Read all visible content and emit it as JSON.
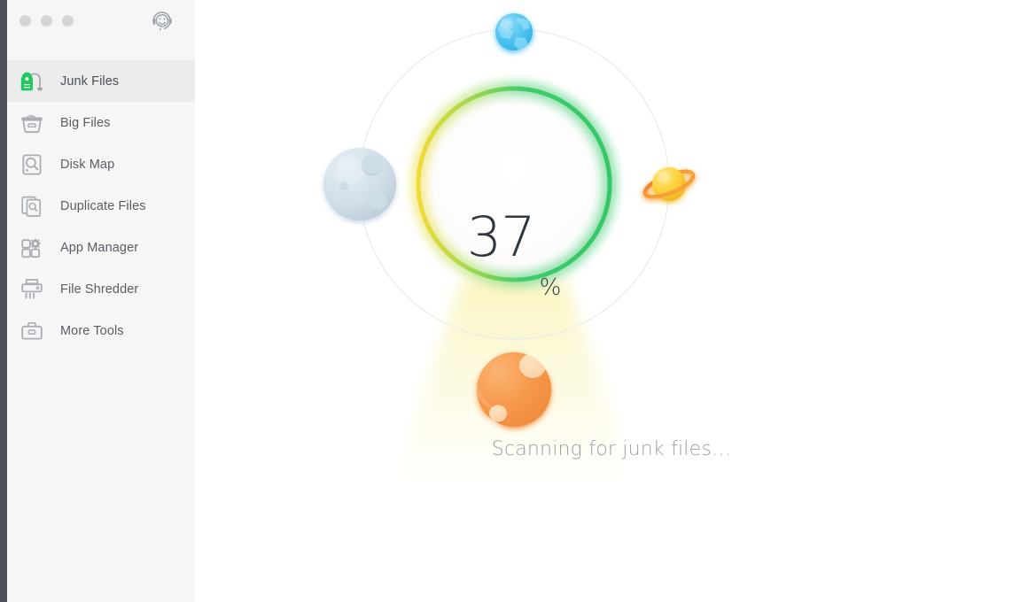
{
  "window": {
    "traffic_lights": [
      "close",
      "minimize",
      "zoom"
    ],
    "support_icon": "support-smiley-icon"
  },
  "sidebar": {
    "items": [
      {
        "label": "Junk Files",
        "icon": "vacuum-cleaner-icon",
        "active": true
      },
      {
        "label": "Big Files",
        "icon": "basket-icon",
        "active": false
      },
      {
        "label": "Disk Map",
        "icon": "disk-magnifier-icon",
        "active": false
      },
      {
        "label": "Duplicate Files",
        "icon": "duplicate-pages-icon",
        "active": false
      },
      {
        "label": "App Manager",
        "icon": "app-grid-gear-icon",
        "active": false
      },
      {
        "label": "File Shredder",
        "icon": "shredder-icon",
        "active": false
      },
      {
        "label": "More Tools",
        "icon": "toolbox-icon",
        "active": false
      }
    ]
  },
  "scan": {
    "percent": "37",
    "percent_symbol": "%",
    "status": "Scanning for junk files…",
    "planets": [
      {
        "name": "earth-planet",
        "position": "top",
        "color": "#4ec3f0"
      },
      {
        "name": "moon-planet",
        "position": "left",
        "color": "#ccdae3"
      },
      {
        "name": "saturn-planet",
        "position": "right",
        "color": "#fbcf2e"
      },
      {
        "name": "mars-planet",
        "position": "bottom",
        "color": "#f59b52"
      }
    ]
  },
  "colors": {
    "ring_green": "#3fcc6e",
    "ring_yellow": "#f4dc3c",
    "accent_green": "#27c34f",
    "sidebar_bg": "#f6f6f6",
    "sidebar_active_bg": "#ececec",
    "edge_strip": "#4c5059",
    "text_muted": "#9aa0a6",
    "text_primary": "#585e66"
  }
}
